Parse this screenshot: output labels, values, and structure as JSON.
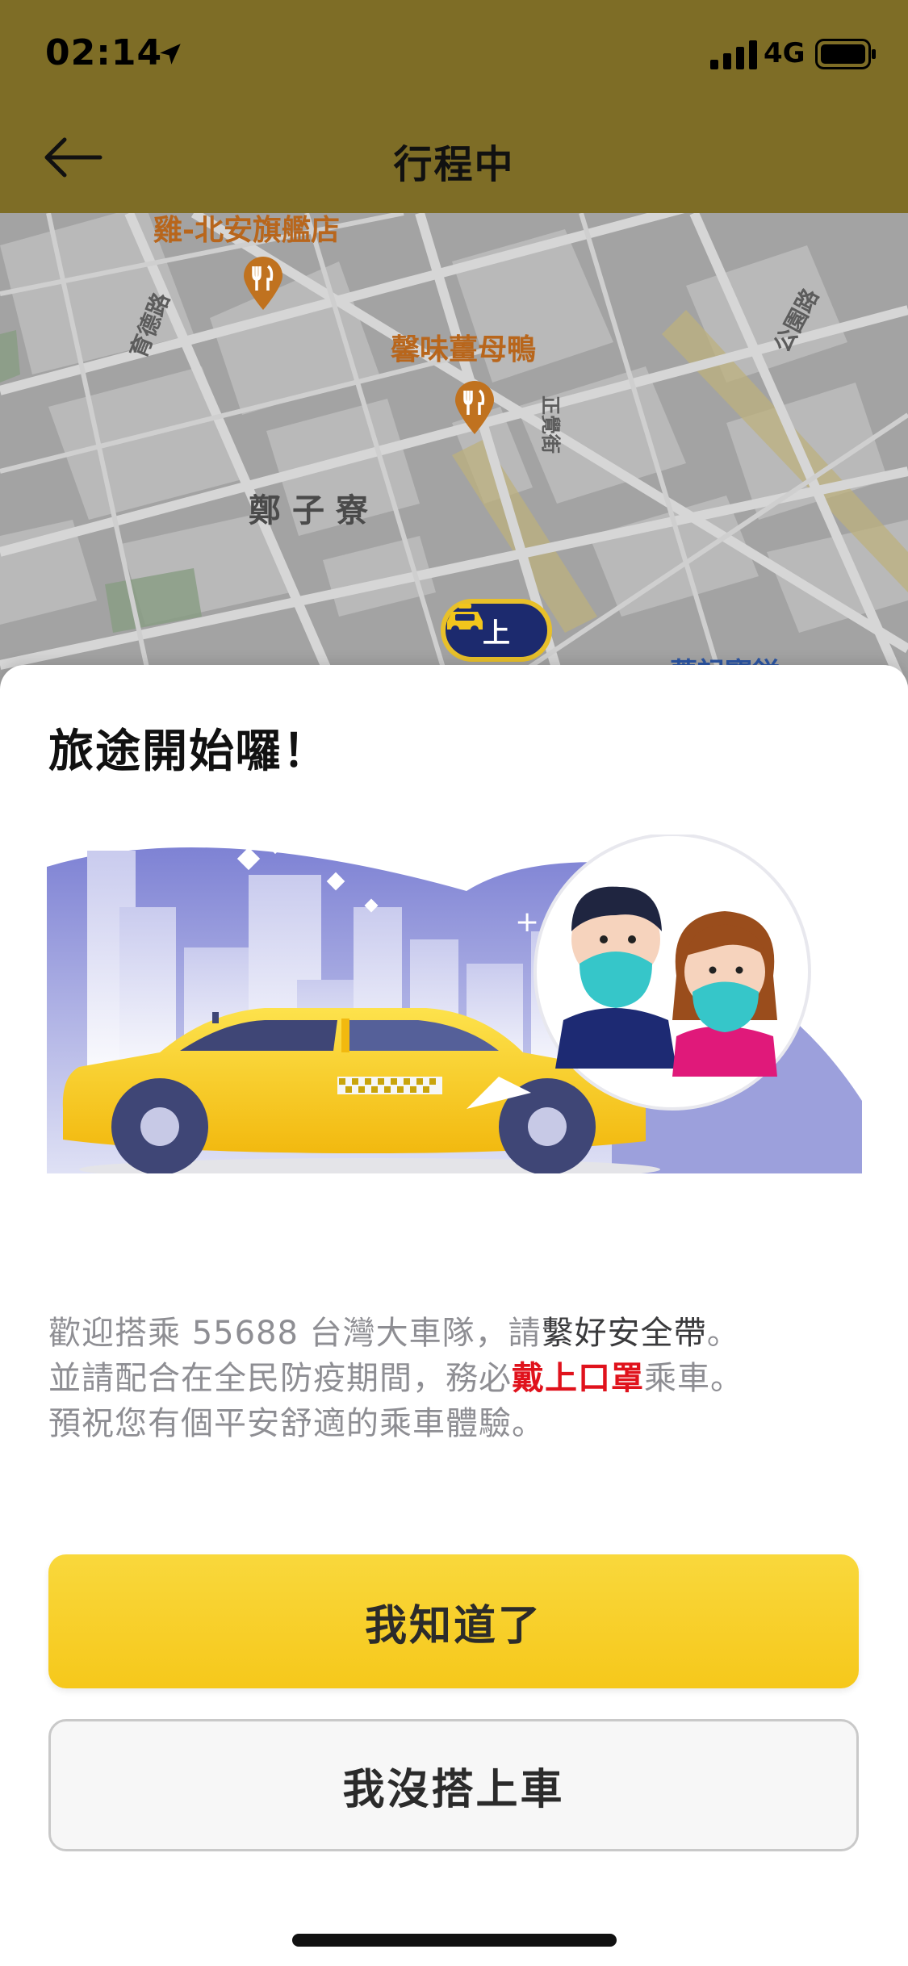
{
  "status_bar": {
    "time": "02:14",
    "network": "4G",
    "icons": [
      "location-arrow-icon",
      "signal-icon",
      "battery-icon"
    ]
  },
  "nav": {
    "title": "行程中",
    "back_icon": "back-arrow-icon"
  },
  "map": {
    "labels": {
      "poi_top": "雞-北安旗艦店",
      "poi_mid": "馨味薑母鴨",
      "district": "鄭子寮",
      "street_left": "育德路",
      "street_center": "正覺街",
      "street_right": "公園路",
      "poi_bottom": "菁記寶鎰"
    },
    "pickup_marker": "上"
  },
  "sheet": {
    "title": "旅途開始囉！",
    "message": {
      "line1_prefix": "歡迎搭乘 55688 台灣大車隊，請",
      "line1_emphasis": "繫好安全帶",
      "line1_suffix": "。",
      "line2_prefix": "並請配合在全民防疫期間，務必",
      "line2_highlight": "戴上口罩",
      "line2_suffix": "乘車。",
      "line3": "預祝您有個平安舒適的乘車體驗。"
    },
    "primary_button": "我知道了",
    "secondary_button": "我沒搭上車"
  },
  "colors": {
    "header_bg": "#7e6d26",
    "primary_button": "#f6c81b",
    "highlight_red": "#e0121c",
    "body_text": "#8e8e93"
  }
}
